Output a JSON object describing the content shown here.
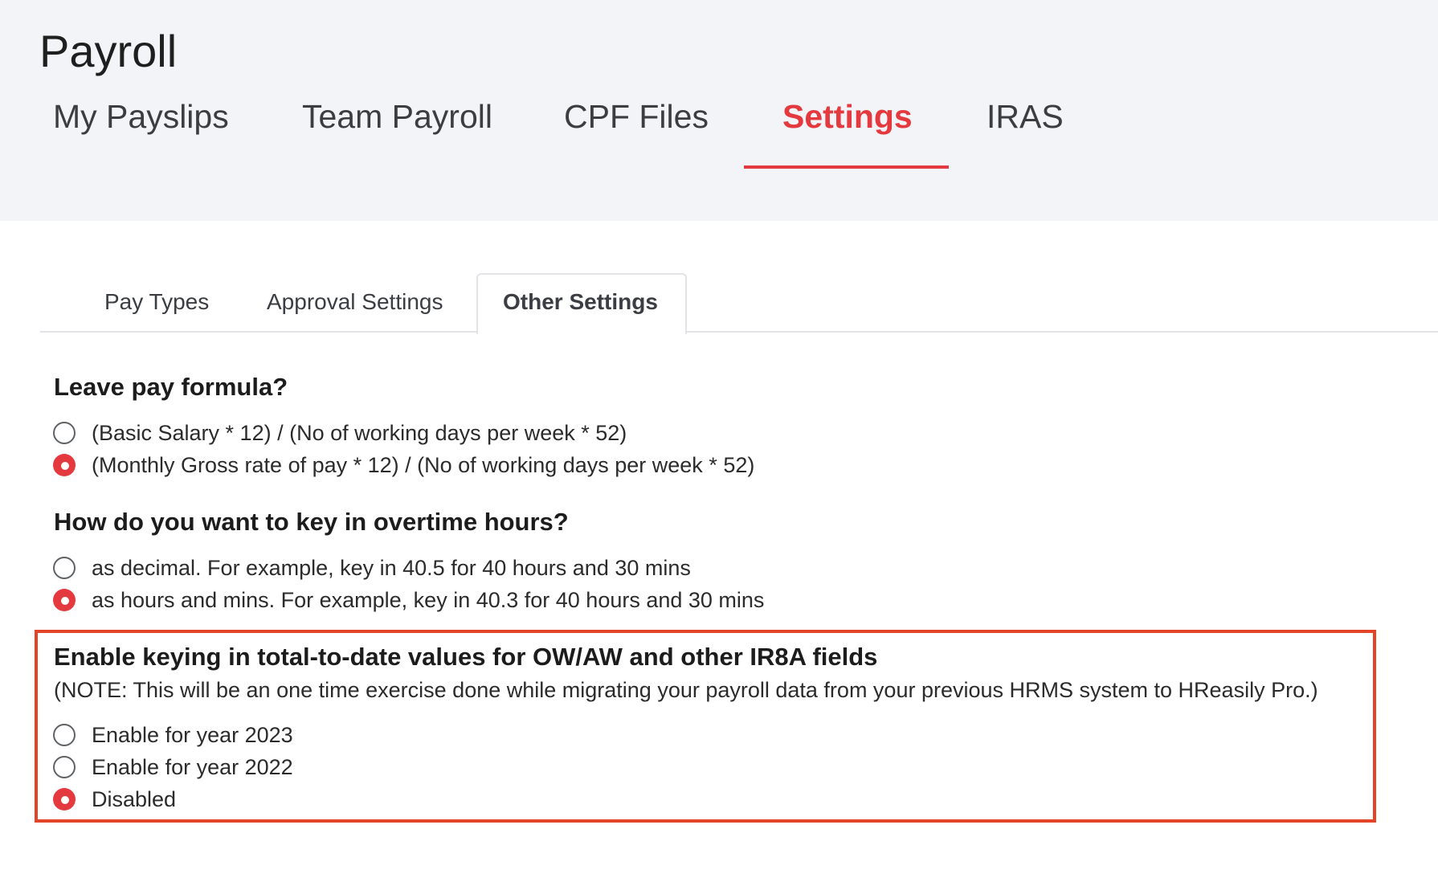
{
  "header": {
    "title": "Payroll",
    "tabs": [
      {
        "label": "My Payslips"
      },
      {
        "label": "Team Payroll"
      },
      {
        "label": "CPF Files"
      },
      {
        "label": "Settings",
        "active": true
      },
      {
        "label": "IRAS"
      }
    ]
  },
  "subtabs": [
    {
      "label": "Pay Types"
    },
    {
      "label": "Approval Settings"
    },
    {
      "label": "Other Settings",
      "active": true
    }
  ],
  "sections": [
    {
      "title": "Leave pay formula?",
      "options": [
        {
          "label": "(Basic Salary * 12) / (No of working days per week * 52)",
          "checked": false
        },
        {
          "label": "(Monthly Gross rate of pay * 12) / (No of working days per week * 52)",
          "checked": true
        }
      ]
    },
    {
      "title": "How do you want to key in overtime hours?",
      "options": [
        {
          "label": "as decimal. For example, key in 40.5 for 40 hours and 30 mins",
          "checked": false
        },
        {
          "label": "as hours and mins. For example, key in 40.3 for 40 hours and 30 mins",
          "checked": true
        }
      ]
    },
    {
      "title": "Enable keying in total-to-date values for OW/AW and other IR8A fields",
      "note": "(NOTE: This will be an one time exercise done while migrating your payroll data from your previous HRMS system to HReasily Pro.)",
      "options": [
        {
          "label": "Enable for year 2023",
          "checked": false
        },
        {
          "label": "Enable for year 2022",
          "checked": false
        },
        {
          "label": "Disabled",
          "checked": true
        }
      ]
    }
  ],
  "colors": {
    "accent": "#e43a3f",
    "highlight_border": "#e34427",
    "header_bg": "#f3f4f7"
  }
}
